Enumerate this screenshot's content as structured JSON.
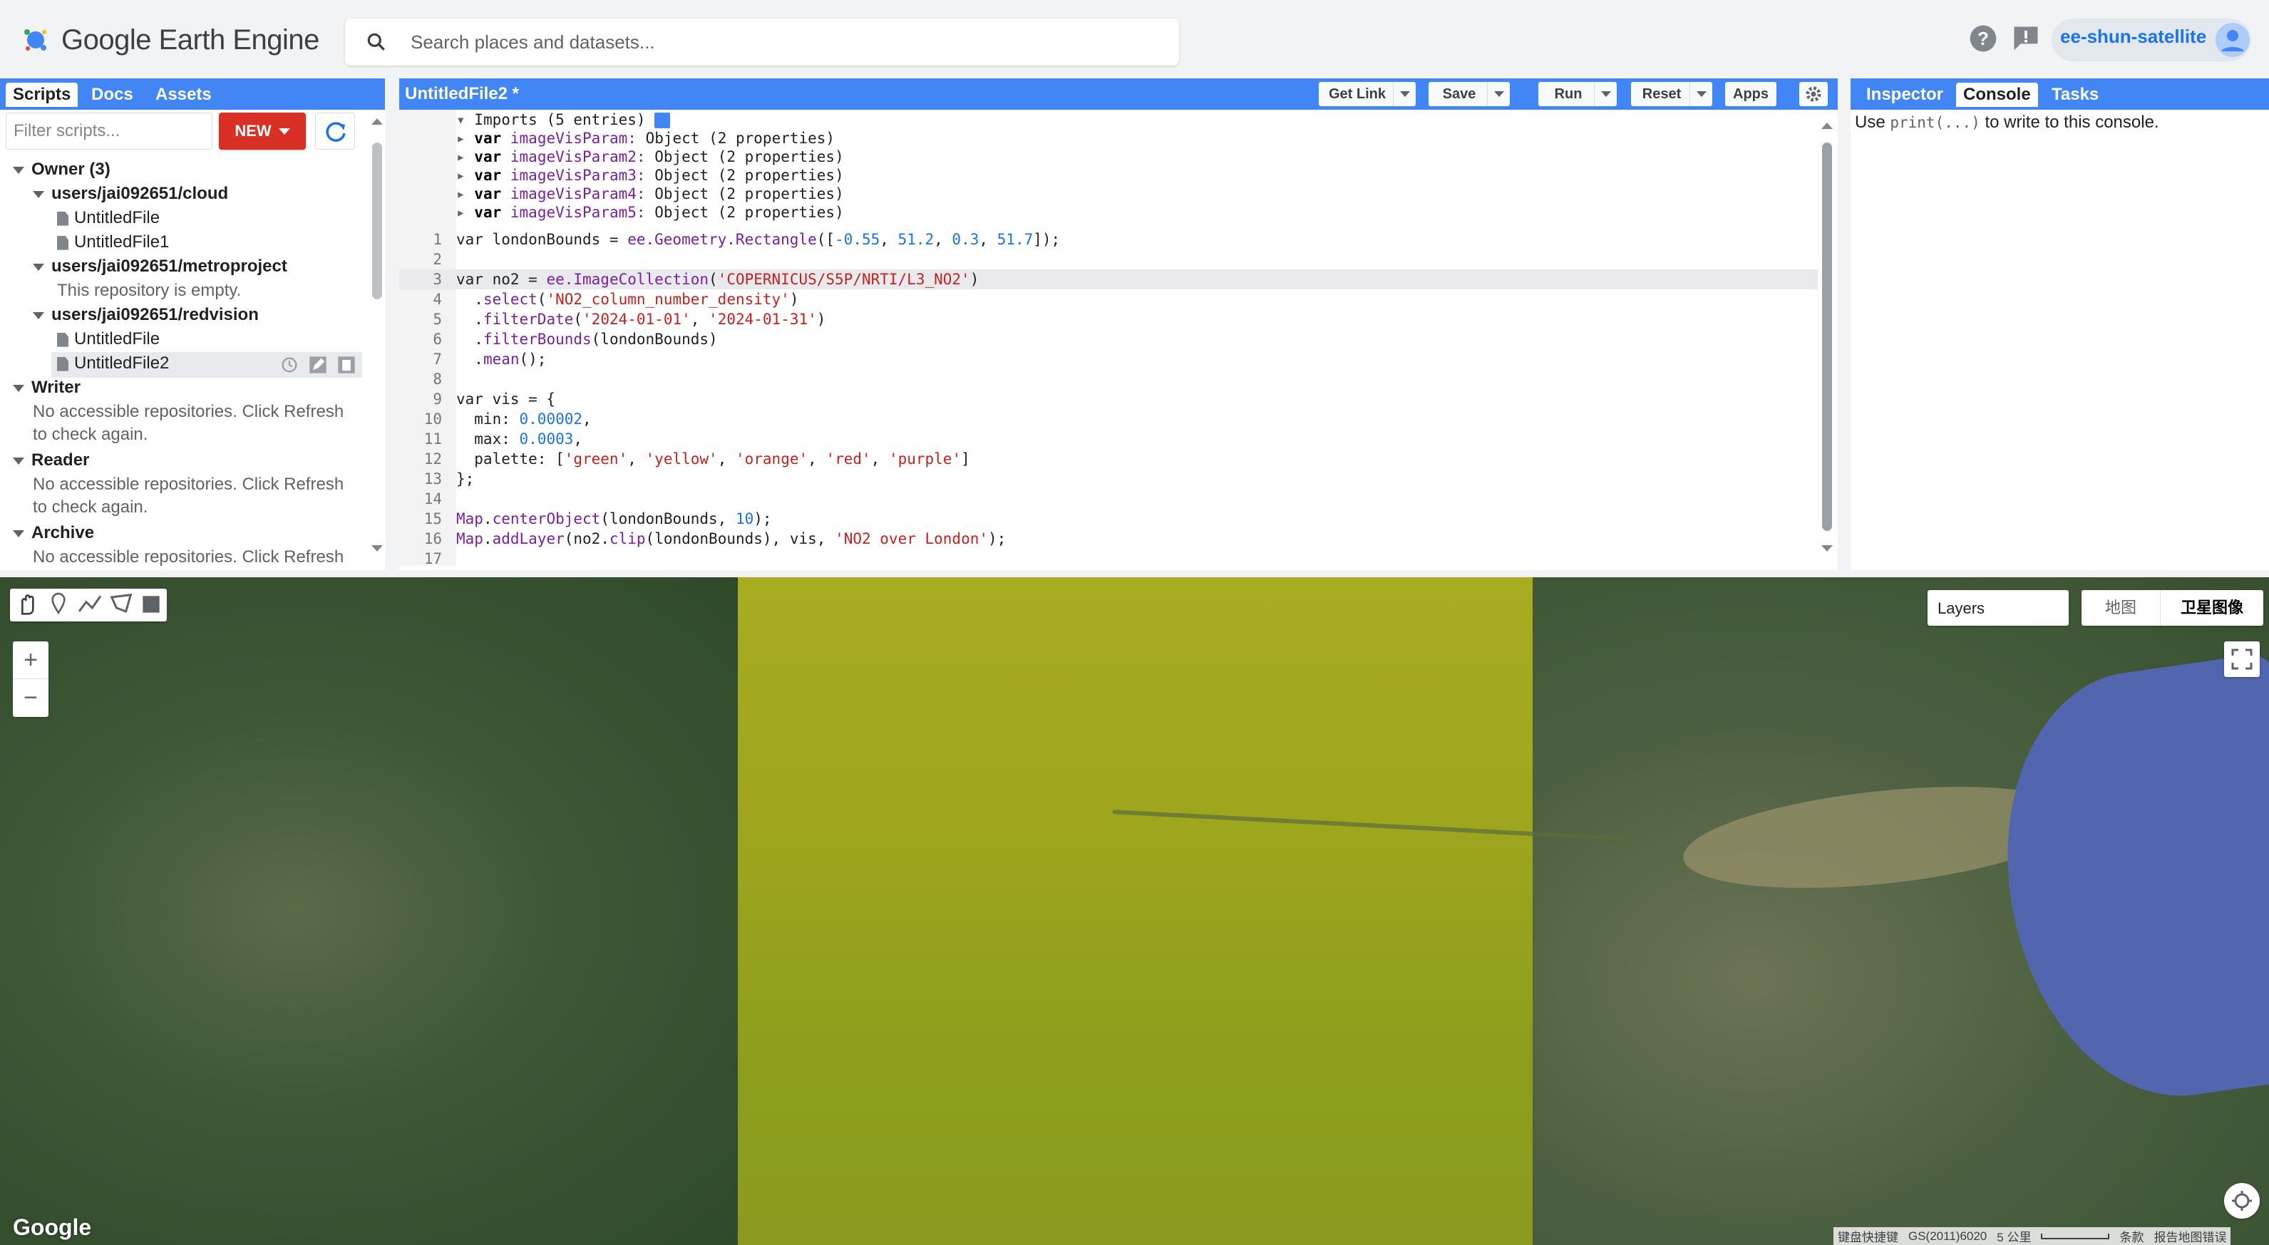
{
  "app": {
    "title": "Google Earth Engine"
  },
  "search": {
    "placeholder": "Search places and datasets..."
  },
  "header": {
    "user": "ee-shun-satellite"
  },
  "left_panel": {
    "tabs": [
      "Scripts",
      "Docs",
      "Assets"
    ],
    "filter_placeholder": "Filter scripts...",
    "new_label": "NEW",
    "tree": {
      "owner": "Owner (3)",
      "repo1": "users/jai092651/cloud",
      "repo1_files": [
        "UntitledFile",
        "UntitledFile1"
      ],
      "repo2": "users/jai092651/metroproject",
      "repo2_empty": "This repository is empty.",
      "repo3": "users/jai092651/redvision",
      "repo3_files": [
        "UntitledFile",
        "UntitledFile2"
      ],
      "writer": "Writer",
      "writer_msg1": "No accessible repositories. Click Refresh",
      "writer_msg2": "to check again.",
      "reader": "Reader",
      "reader_msg1": "No accessible repositories. Click Refresh",
      "reader_msg2": "to check again.",
      "archive": "Archive",
      "archive_msg1": "No accessible repositories. Click Refresh"
    }
  },
  "editor": {
    "file_title": "UntitledFile2 *",
    "buttons": {
      "get_link": "Get Link",
      "save": "Save",
      "run": "Run",
      "reset": "Reset",
      "apps": "Apps"
    },
    "imports_header": "Imports (5 entries)",
    "imports": [
      {
        "kw": "var",
        "name": "imageVisParam:",
        "value": "Object (2 properties)"
      },
      {
        "kw": "var",
        "name": "imageVisParam2:",
        "value": "Object (2 properties)"
      },
      {
        "kw": "var",
        "name": "imageVisParam3:",
        "value": "Object (2 properties)"
      },
      {
        "kw": "var",
        "name": "imageVisParam4:",
        "value": "Object (2 properties)"
      },
      {
        "kw": "var",
        "name": "imageVisParam5:",
        "value": "Object (2 properties)"
      }
    ],
    "line_numbers": [
      "1",
      "2",
      "3",
      "4",
      "5",
      "6",
      "7",
      "8",
      "9",
      "10",
      "11",
      "12",
      "13",
      "14",
      "15",
      "16",
      "17"
    ],
    "code": {
      "l1": [
        "var londonBounds = ",
        "ee.Geometry.Rectangle",
        "([",
        "-0.55",
        ", ",
        "51.2",
        ", ",
        "0.3",
        ", ",
        "51.7",
        "]);"
      ],
      "l3": [
        "var no2 = ",
        "ee.ImageCollection",
        "(",
        "'COPERNICUS/S5P/NRTI/L3_NO2'",
        ")"
      ],
      "l4": [
        "  .",
        "select",
        "(",
        "'NO2_column_number_density'",
        ")"
      ],
      "l5": [
        "  .",
        "filterDate",
        "(",
        "'2024-01-01'",
        ", ",
        "'2024-01-31'",
        ")"
      ],
      "l6": [
        "  .",
        "filterBounds",
        "(londonBounds)"
      ],
      "l7": [
        "  .",
        "mean",
        "();"
      ],
      "l9": "var vis = {",
      "l10": [
        "  min: ",
        "0.00002",
        ","
      ],
      "l11": [
        "  max: ",
        "0.0003",
        ","
      ],
      "l12": [
        "  palette: [",
        "'green'",
        ", ",
        "'yellow'",
        ", ",
        "'orange'",
        ", ",
        "'red'",
        ", ",
        "'purple'",
        "]"
      ],
      "l13": "};",
      "l15": [
        "Map",
        ".",
        "centerObject",
        "(londonBounds, ",
        "10",
        ");"
      ],
      "l16": [
        "Map",
        ".",
        "addLayer",
        "(no2.",
        "clip",
        "(londonBounds), vis, ",
        "'NO2 over London'",
        ");"
      ]
    }
  },
  "right_panel": {
    "tabs": [
      "Inspector",
      "Console",
      "Tasks"
    ],
    "console_pre": "Use ",
    "console_code": "print(...)",
    "console_post": " to write to this console."
  },
  "map": {
    "layers_label": "Layers",
    "map_type": [
      "地图",
      "卫星图像"
    ],
    "google": "Google",
    "attribution": [
      "键盘快捷键",
      "GS(2011)6020",
      "5 公里",
      "条款",
      "报告地图错误"
    ],
    "overlay_color": "#a8ac20",
    "water_color": "#5266b0"
  },
  "colors": {
    "accent": "#4285f4",
    "new_button": "#d93025",
    "link": "#1a73e8"
  }
}
